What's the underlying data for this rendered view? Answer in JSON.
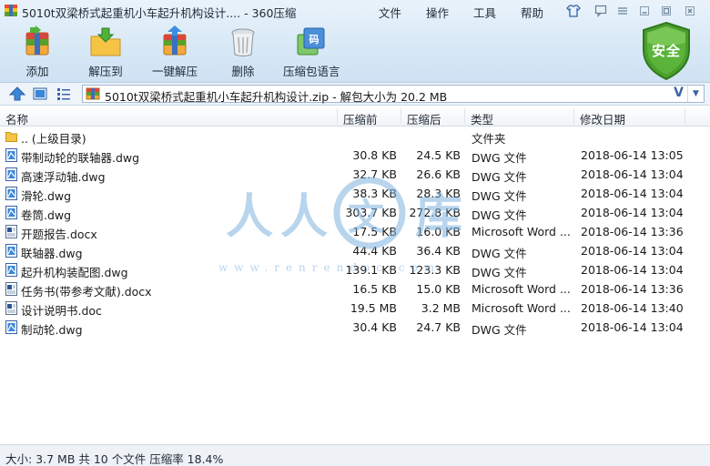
{
  "window": {
    "title": "5010t双梁桥式起重机小车起升机构设计.... - 360压缩",
    "menus": [
      "文件",
      "操作",
      "工具",
      "帮助"
    ]
  },
  "toolbar": {
    "add_label": "添加",
    "extract_to_label": "解压到",
    "one_click_extract_label": "一键解压",
    "delete_label": "删除",
    "compress_lang_label": "压缩包语言",
    "security_label": "安全"
  },
  "address": {
    "path_text": "5010t双梁桥式起重机小车起升机构设计.zip - 解包大小为 20.2 MB",
    "v_glyph": "V"
  },
  "columns": {
    "name": "名称",
    "compressed": "压缩前",
    "after": "压缩后",
    "type": "类型",
    "modified": "修改日期"
  },
  "files": [
    {
      "name": ".. (上级目录)",
      "before": "",
      "after": "",
      "type": "文件夹",
      "date": "",
      "kind": "folder"
    },
    {
      "name": "带制动轮的联轴器.dwg",
      "before": "30.8 KB",
      "after": "24.5 KB",
      "type": "DWG 文件",
      "date": "2018-06-14 13:05",
      "kind": "dwg"
    },
    {
      "name": "高速浮动轴.dwg",
      "before": "32.7 KB",
      "after": "26.6 KB",
      "type": "DWG 文件",
      "date": "2018-06-14 13:04",
      "kind": "dwg"
    },
    {
      "name": "滑轮.dwg",
      "before": "38.3 KB",
      "after": "28.3 KB",
      "type": "DWG 文件",
      "date": "2018-06-14 13:04",
      "kind": "dwg"
    },
    {
      "name": "卷筒.dwg",
      "before": "303.7 KB",
      "after": "272.8 KB",
      "type": "DWG 文件",
      "date": "2018-06-14 13:04",
      "kind": "dwg"
    },
    {
      "name": "开题报告.docx",
      "before": "17.5 KB",
      "after": "16.0 KB",
      "type": "Microsoft Word ...",
      "date": "2018-06-14 13:36",
      "kind": "doc"
    },
    {
      "name": "联轴器.dwg",
      "before": "44.4 KB",
      "after": "36.4 KB",
      "type": "DWG 文件",
      "date": "2018-06-14 13:04",
      "kind": "dwg"
    },
    {
      "name": "起升机构装配图.dwg",
      "before": "139.1 KB",
      "after": "123.3 KB",
      "type": "DWG 文件",
      "date": "2018-06-14 13:04",
      "kind": "dwg"
    },
    {
      "name": "任务书(带参考文献).docx",
      "before": "16.5 KB",
      "after": "15.0 KB",
      "type": "Microsoft Word ...",
      "date": "2018-06-14 13:36",
      "kind": "doc"
    },
    {
      "name": "设计说明书.doc",
      "before": "19.5 MB",
      "after": "3.2 MB",
      "type": "Microsoft Word ...",
      "date": "2018-06-14 13:40",
      "kind": "doc"
    },
    {
      "name": "制动轮.dwg",
      "before": "30.4 KB",
      "after": "24.7 KB",
      "type": "DWG 文件",
      "date": "2018-06-14 13:04",
      "kind": "dwg"
    }
  ],
  "watermark": {
    "chars": [
      "人",
      "人",
      "文",
      "库"
    ],
    "url": "www.renrendoc.com"
  },
  "status": {
    "text": "大小: 3.7 MB 共 10 个文件 压缩率 18.4%"
  },
  "colors": {
    "accent": "#3a63a8",
    "shield_green": "#4a9e2e",
    "header_bg": "#d7e8f6"
  }
}
